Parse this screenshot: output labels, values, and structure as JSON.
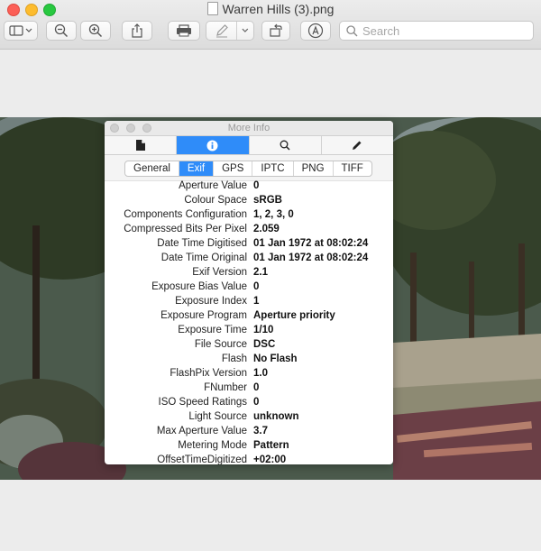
{
  "window": {
    "title": "Warren Hills (3).png"
  },
  "toolbar": {
    "search_placeholder": "Search"
  },
  "info_panel": {
    "title": "More Info",
    "tabs": [
      "General",
      "Exif",
      "GPS",
      "IPTC",
      "PNG",
      "TIFF"
    ],
    "selected_tab": "Exif",
    "rows": [
      {
        "key": "Aperture Value",
        "value": "0"
      },
      {
        "key": "Colour Space",
        "value": "sRGB"
      },
      {
        "key": "Components Configuration",
        "value": "1, 2, 3, 0"
      },
      {
        "key": "Compressed Bits Per Pixel",
        "value": "2.059"
      },
      {
        "key": "Date Time Digitised",
        "value": "01 Jan 1972 at 08:02:24"
      },
      {
        "key": "Date Time Original",
        "value": "01 Jan 1972 at 08:02:24"
      },
      {
        "key": "Exif Version",
        "value": "2.1"
      },
      {
        "key": "Exposure Bias Value",
        "value": "0"
      },
      {
        "key": "Exposure Index",
        "value": "1"
      },
      {
        "key": "Exposure Program",
        "value": "Aperture priority"
      },
      {
        "key": "Exposure Time",
        "value": "1/10"
      },
      {
        "key": "File Source",
        "value": "DSC"
      },
      {
        "key": "Flash",
        "value": "No Flash"
      },
      {
        "key": "FlashPix Version",
        "value": "1.0"
      },
      {
        "key": "FNumber",
        "value": "0"
      },
      {
        "key": "ISO Speed Ratings",
        "value": "0"
      },
      {
        "key": "Light Source",
        "value": "unknown"
      },
      {
        "key": "Max Aperture Value",
        "value": "3.7"
      },
      {
        "key": "Metering Mode",
        "value": "Pattern"
      },
      {
        "key": "OffsetTimeDigitized",
        "value": "+02:00"
      }
    ]
  },
  "colors": {
    "accent": "#2f8cf9"
  }
}
